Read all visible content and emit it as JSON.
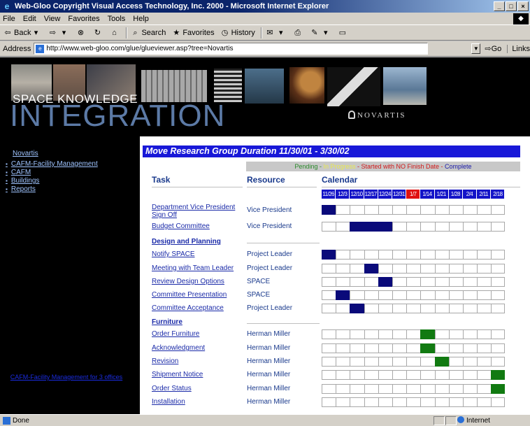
{
  "window": {
    "title": "Web-Gloo Copyright Visual Access Technology, Inc. 2000 - Microsoft Internet Explorer"
  },
  "menu": [
    "File",
    "Edit",
    "View",
    "Favorites",
    "Tools",
    "Help"
  ],
  "toolbar": {
    "back": "Back",
    "search": "Search",
    "favorites": "Favorites",
    "history": "History"
  },
  "address": {
    "label": "Address",
    "url": "http://www.web-gloo.com/glue/glueviewer.asp?tree=Novartis",
    "go": "Go",
    "links": "Links"
  },
  "banner": {
    "line1": "SPACE KNOWLEDGE",
    "line2": "INTEGRATION",
    "brand": "NOVARTIS"
  },
  "nav": {
    "top": "Novartis",
    "level1": "CAFM-Facility Management",
    "items": [
      "CAFM",
      "Buildings",
      "Reports"
    ],
    "footer": "CAFM-Facility Management for 3 offices"
  },
  "main": {
    "title": "Move Research Group Duration 11/30/01 - 3/30/02",
    "legend": {
      "pending": "Pending - ",
      "highlight": "In Progress",
      "started": " - Started with NO Finish Date - ",
      "complete": "Complete"
    },
    "col_task": "Task",
    "col_resource": "Resource",
    "col_calendar": "Calendar",
    "dates": [
      "11/26",
      "12/3",
      "12/10",
      "12/17",
      "12/24",
      "12/31",
      "1/7",
      "1/14",
      "1/21",
      "1/28",
      "2/4",
      "2/11",
      "2/18"
    ],
    "highlight_date_index": 6,
    "colors": {
      "scheduled": "#0a0a7a",
      "furniture": "#117a11",
      "header": "#1818d8",
      "today": "#e01010"
    },
    "rows": [
      {
        "task": "Department Vice President Sign Off",
        "resource": "Vice President",
        "section": false,
        "filled": [
          0
        ],
        "color": "navy"
      },
      {
        "task": "Budget Committee",
        "resource": "Vice President",
        "section": false,
        "filled": [
          2,
          3,
          4
        ],
        "color": "navy"
      },
      {
        "task": "Design and Planning",
        "resource": "",
        "section": true,
        "filled": [],
        "color": ""
      },
      {
        "task": "Notify SPACE",
        "resource": "Project Leader",
        "section": false,
        "filled": [
          0
        ],
        "color": "navy"
      },
      {
        "task": "Meeting with Team Leader",
        "resource": "Project Leader",
        "section": false,
        "filled": [
          3
        ],
        "color": "navy"
      },
      {
        "task": "Review Design Options",
        "resource": "SPACE",
        "section": false,
        "filled": [
          4
        ],
        "color": "navy"
      },
      {
        "task": "Committee Presentation",
        "resource": "SPACE",
        "section": false,
        "filled": [
          1
        ],
        "color": "navy"
      },
      {
        "task": "Committee Acceptance",
        "resource": "Project Leader",
        "section": false,
        "filled": [
          2
        ],
        "color": "navy"
      },
      {
        "task": "Furniture",
        "resource": "",
        "section": true,
        "filled": [],
        "color": ""
      },
      {
        "task": "Order Furniture",
        "resource": "Herman Miller",
        "section": false,
        "filled": [
          7
        ],
        "color": "green"
      },
      {
        "task": "Acknowledgment",
        "resource": "Herman Miller",
        "section": false,
        "filled": [
          7
        ],
        "color": "green"
      },
      {
        "task": "Revision",
        "resource": "Herman Miller",
        "section": false,
        "filled": [
          8
        ],
        "color": "green"
      },
      {
        "task": "Shipment Notice",
        "resource": "Herman Miller",
        "section": false,
        "filled": [
          12
        ],
        "color": "green"
      },
      {
        "task": "Order Status",
        "resource": "Herman Miller",
        "section": false,
        "filled": [
          12
        ],
        "color": "green"
      },
      {
        "task": "Installation",
        "resource": "Herman Miller",
        "section": false,
        "filled": [],
        "color": ""
      }
    ]
  },
  "status": {
    "left": "Done",
    "zone": "Internet"
  }
}
